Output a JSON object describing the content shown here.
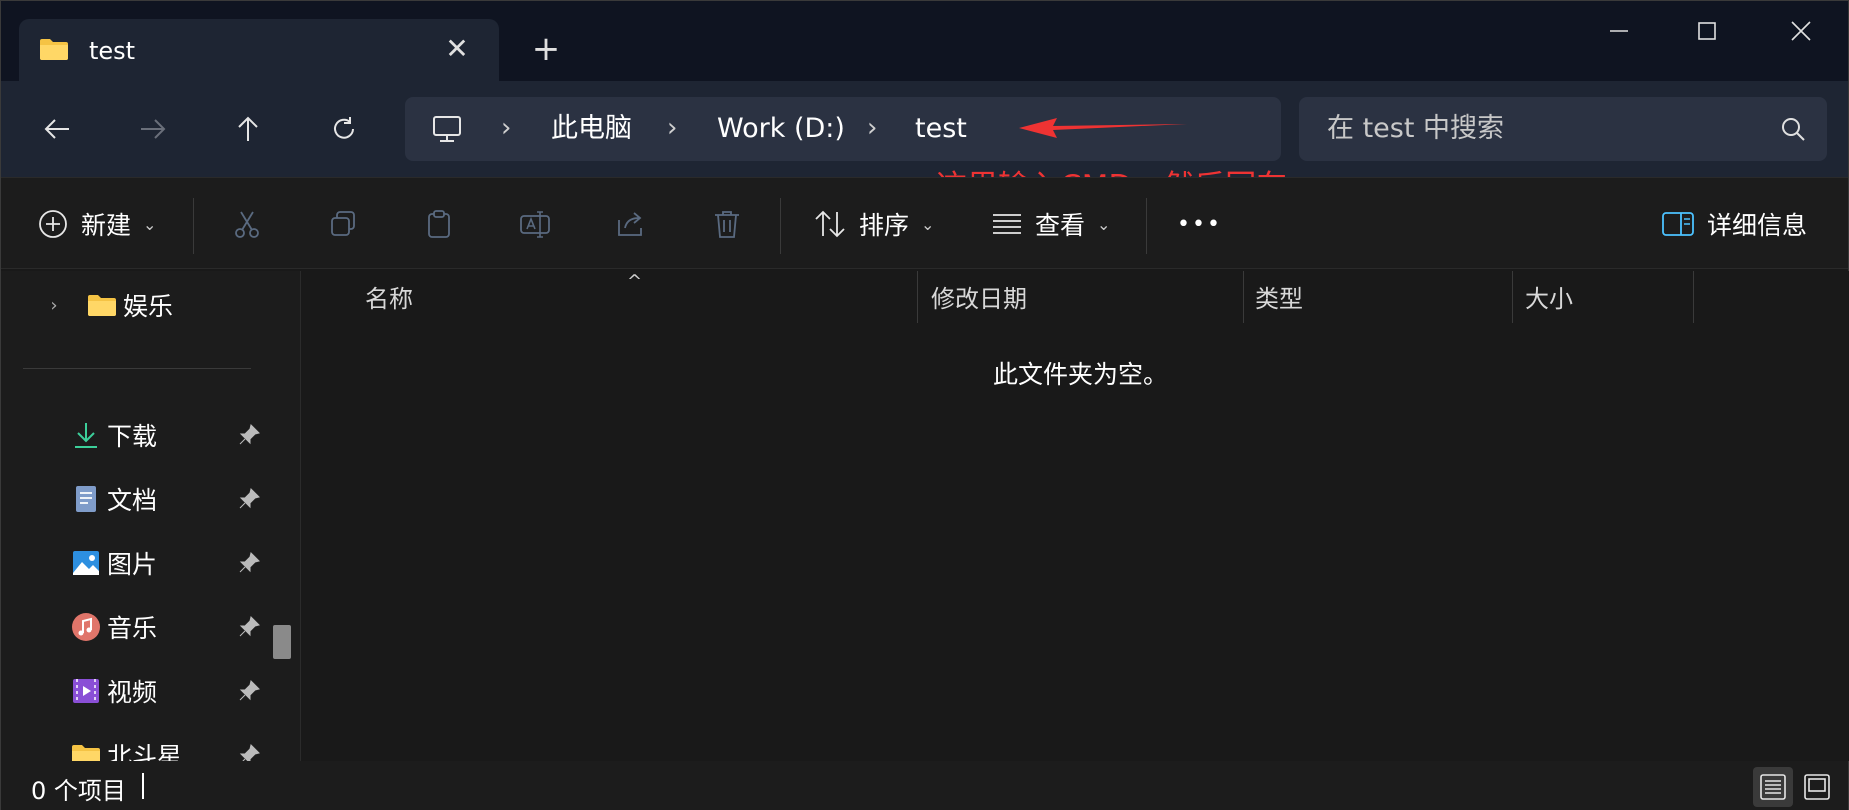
{
  "tab": {
    "title": "test",
    "close_glyph": "✕",
    "new_tab_glyph": "+"
  },
  "address": {
    "segments": [
      "此电脑",
      "Work (D:)",
      "test"
    ],
    "separator": "›"
  },
  "search": {
    "placeholder": "在 test 中搜索"
  },
  "annotation": {
    "text": "这里输入CMD，然后回车",
    "color": "#ee3333"
  },
  "toolbar": {
    "new_label": "新建",
    "sort_label": "排序",
    "view_label": "查看",
    "more_glyph": "•••",
    "details_label": "详细信息"
  },
  "sidebar": {
    "items": [
      {
        "label": "娱乐",
        "icon": "folder-icon",
        "pinned": false
      },
      {
        "label": "下载",
        "icon": "download-icon",
        "pinned": true
      },
      {
        "label": "文档",
        "icon": "documents-icon",
        "pinned": true
      },
      {
        "label": "图片",
        "icon": "pictures-icon",
        "pinned": true
      },
      {
        "label": "音乐",
        "icon": "music-icon",
        "pinned": true
      },
      {
        "label": "视频",
        "icon": "videos-icon",
        "pinned": true
      },
      {
        "label": "北斗星",
        "icon": "folder-icon",
        "pinned": true
      }
    ]
  },
  "columns": [
    "名称",
    "修改日期",
    "类型",
    "大小"
  ],
  "content": {
    "empty_message": "此文件夹为空。"
  },
  "status": {
    "item_count": "0 个项目"
  },
  "colors": {
    "accent": "#4cc2ff",
    "folder": "#f5c344",
    "titlebar": "#0f1421",
    "navbar": "#1e2533"
  }
}
